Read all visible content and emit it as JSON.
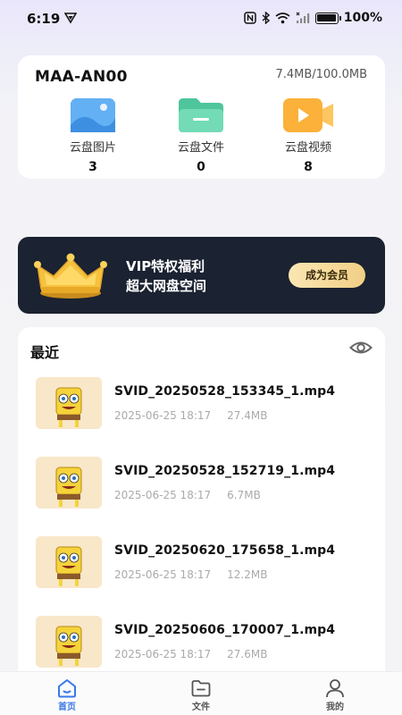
{
  "status_bar": {
    "time": "6:19",
    "battery": "100%",
    "battery_level": 1.0
  },
  "storage": {
    "device_name": "MAA-AN00",
    "usage": "7.4MB/100.0MB",
    "items": [
      {
        "label": "云盘图片",
        "count": "3",
        "icon": "image-folder-icon",
        "color": "#5aa6f0"
      },
      {
        "label": "云盘文件",
        "count": "0",
        "icon": "file-folder-icon",
        "color": "#5ecfa8"
      },
      {
        "label": "云盘视频",
        "count": "8",
        "icon": "video-folder-icon",
        "color": "#f8b43c"
      }
    ]
  },
  "vip": {
    "title": "VIP特权福利",
    "subtitle": "超大网盘空间",
    "button": "成为会员"
  },
  "recent": {
    "title": "最近",
    "files": [
      {
        "name": "SVID_20250528_153345_1.mp4",
        "date": "2025-06-25 18:17",
        "size": "27.4MB"
      },
      {
        "name": "SVID_20250528_152719_1.mp4",
        "date": "2025-06-25 18:17",
        "size": "6.7MB"
      },
      {
        "name": "SVID_20250620_175658_1.mp4",
        "date": "2025-06-25 18:17",
        "size": "12.2MB"
      },
      {
        "name": "SVID_20250606_170007_1.mp4",
        "date": "2025-06-25 18:17",
        "size": "27.6MB"
      }
    ]
  },
  "nav": {
    "items": [
      {
        "label": "首页",
        "icon": "home-icon",
        "active": true
      },
      {
        "label": "文件",
        "icon": "folder-icon",
        "active": false
      },
      {
        "label": "我的",
        "icon": "profile-icon",
        "active": false
      }
    ]
  },
  "colors": {
    "accent": "#3a78e8",
    "vip_bg": "#1b2231",
    "vip_button": "#f1cf85"
  }
}
